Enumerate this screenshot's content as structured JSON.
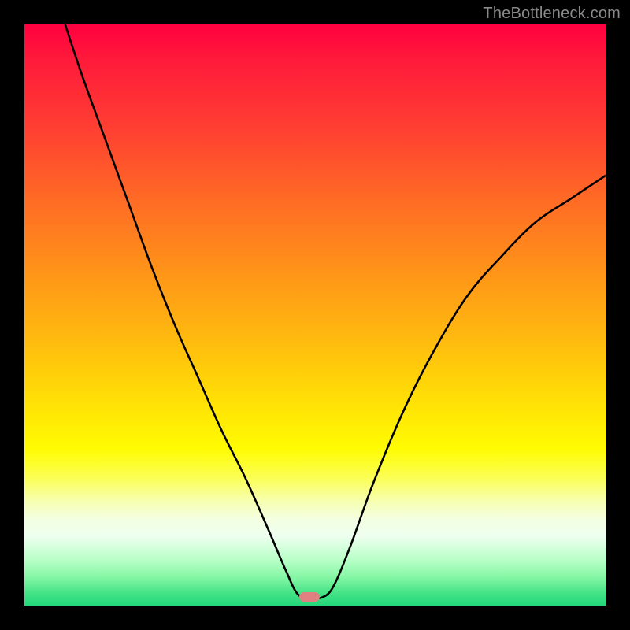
{
  "watermark": "TheBottleneck.com",
  "colors": {
    "background": "#000000",
    "gradient_top": "#ff0040",
    "gradient_mid": "#ffe405",
    "gradient_bottom": "#22d87a",
    "curve": "#000000",
    "marker": "#e08080",
    "watermark_text": "#8a8a8a"
  },
  "chart_data": {
    "type": "line",
    "title": "",
    "xlabel": "",
    "ylabel": "",
    "xlim": [
      0,
      100
    ],
    "ylim": [
      0,
      100
    ],
    "vertex_x": 49,
    "marker": {
      "x": 49,
      "y": 1.5,
      "shape": "pill"
    },
    "left_branch": [
      {
        "x": 7,
        "y": 100
      },
      {
        "x": 10,
        "y": 91
      },
      {
        "x": 14,
        "y": 80
      },
      {
        "x": 18,
        "y": 69
      },
      {
        "x": 22,
        "y": 58
      },
      {
        "x": 26,
        "y": 48
      },
      {
        "x": 30,
        "y": 39
      },
      {
        "x": 34,
        "y": 30
      },
      {
        "x": 38,
        "y": 22
      },
      {
        "x": 42,
        "y": 13
      },
      {
        "x": 45,
        "y": 6
      },
      {
        "x": 47,
        "y": 2
      },
      {
        "x": 49,
        "y": 1.3
      }
    ],
    "right_branch": [
      {
        "x": 51,
        "y": 1.3
      },
      {
        "x": 53,
        "y": 3
      },
      {
        "x": 56,
        "y": 10
      },
      {
        "x": 60,
        "y": 21
      },
      {
        "x": 65,
        "y": 33
      },
      {
        "x": 70,
        "y": 43
      },
      {
        "x": 76,
        "y": 53
      },
      {
        "x": 82,
        "y": 60
      },
      {
        "x": 88,
        "y": 66
      },
      {
        "x": 94,
        "y": 70
      },
      {
        "x": 100,
        "y": 74
      }
    ]
  }
}
